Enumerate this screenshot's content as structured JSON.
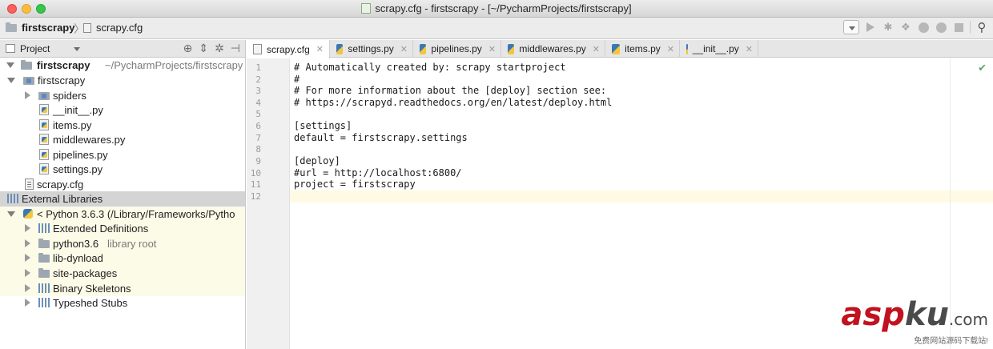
{
  "window": {
    "title": "scrapy.cfg - firstscrapy - [~/PycharmProjects/firstscrapy]"
  },
  "breadcrumb": {
    "project": "firstscrapy",
    "file": "scrapy.cfg"
  },
  "project_panel": {
    "label": "Project"
  },
  "tree": {
    "root_name": "firstscrapy",
    "root_path": "~/PycharmProjects/firstscrapy",
    "package": "firstscrapy",
    "spiders": "spiders",
    "init": "__init__.py",
    "items": "items.py",
    "middlewares": "middlewares.py",
    "pipelines": "pipelines.py",
    "settings": "settings.py",
    "cfg": "scrapy.cfg",
    "external": "External Libraries",
    "python": "< Python 3.6.3 (/Library/Frameworks/Pytho",
    "ext_defs": "Extended Definitions",
    "python36": "python3.6",
    "library_root": "library root",
    "lib_dynload": "lib-dynload",
    "site_packages": "site-packages",
    "binary_skeletons": "Binary Skeletons",
    "typeshed": "Typeshed Stubs"
  },
  "tabs": [
    {
      "label": "scrapy.cfg",
      "active": true
    },
    {
      "label": "settings.py"
    },
    {
      "label": "pipelines.py"
    },
    {
      "label": "middlewares.py"
    },
    {
      "label": "items.py"
    },
    {
      "label": "__init__.py"
    }
  ],
  "editor": {
    "line_numbers": [
      "1",
      "2",
      "3",
      "4",
      "5",
      "6",
      "7",
      "8",
      "9",
      "10",
      "11",
      "12"
    ],
    "lines": [
      "# Automatically created by: scrapy startproject",
      "#",
      "# For more information about the [deploy] section see:",
      "# https://scrapyd.readthedocs.org/en/latest/deploy.html",
      "",
      "[settings]",
      "default = firstscrapy.settings",
      "",
      "[deploy]",
      "#url = http://localhost:6800/",
      "project = firstscrapy",
      ""
    ],
    "current_line": 12
  },
  "watermark": {
    "logo_a": "asp",
    "logo_k": "ku",
    "logo_c": ".com",
    "subtitle": "免费网站源码下载站!"
  },
  "icons": {
    "close": "close-icon",
    "run": "run-icon",
    "debug": "debug-icon",
    "search": "search-icon"
  },
  "colors": {
    "selection": "#d4d4d4",
    "library_bg": "#fbfbe8",
    "current_line": "#fffae3",
    "watermark_red": "#c1121f"
  }
}
